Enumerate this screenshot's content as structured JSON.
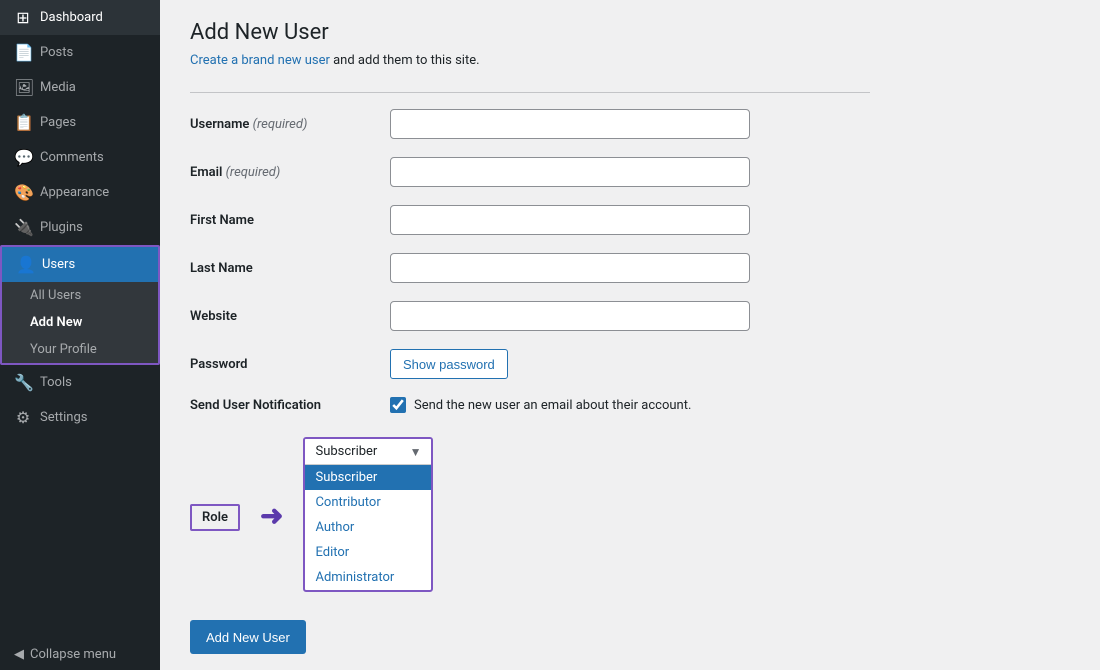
{
  "sidebar": {
    "items": [
      {
        "id": "dashboard",
        "label": "Dashboard",
        "icon": "⊞"
      },
      {
        "id": "posts",
        "label": "Posts",
        "icon": "📄"
      },
      {
        "id": "media",
        "label": "Media",
        "icon": "🖼"
      },
      {
        "id": "pages",
        "label": "Pages",
        "icon": "📋"
      },
      {
        "id": "comments",
        "label": "Comments",
        "icon": "💬"
      },
      {
        "id": "appearance",
        "label": "Appearance",
        "icon": "🎨"
      },
      {
        "id": "plugins",
        "label": "Plugins",
        "icon": "🔌"
      },
      {
        "id": "users",
        "label": "Users",
        "icon": "👤"
      },
      {
        "id": "tools",
        "label": "Tools",
        "icon": "🔧"
      },
      {
        "id": "settings",
        "label": "Settings",
        "icon": "⚙"
      }
    ],
    "submenu": {
      "parent": "users",
      "items": [
        {
          "id": "all-users",
          "label": "All Users"
        },
        {
          "id": "add-new",
          "label": "Add New"
        },
        {
          "id": "your-profile",
          "label": "Your Profile"
        }
      ]
    },
    "collapse_label": "Collapse menu"
  },
  "page": {
    "title": "Add New User",
    "subtitle_text": "Create a brand new user and add them to this site.",
    "subtitle_link": "Create a brand new user"
  },
  "form": {
    "username_label": "Username",
    "username_required": "(required)",
    "username_placeholder": "",
    "email_label": "Email",
    "email_required": "(required)",
    "email_placeholder": "",
    "firstname_label": "First Name",
    "firstname_placeholder": "",
    "lastname_label": "Last Name",
    "lastname_placeholder": "",
    "website_label": "Website",
    "website_placeholder": "",
    "password_label": "Password",
    "show_password_label": "Show password",
    "notification_label": "Send User Notification",
    "notification_text": "Send the new user an email about their account.",
    "role_label": "Role",
    "add_button_label": "Add New User"
  },
  "role_dropdown": {
    "selected": "Subscriber",
    "options": [
      {
        "id": "subscriber",
        "label": "Subscriber",
        "selected": true
      },
      {
        "id": "contributor",
        "label": "Contributor"
      },
      {
        "id": "author",
        "label": "Author"
      },
      {
        "id": "editor",
        "label": "Editor"
      },
      {
        "id": "administrator",
        "label": "Administrator"
      }
    ]
  }
}
